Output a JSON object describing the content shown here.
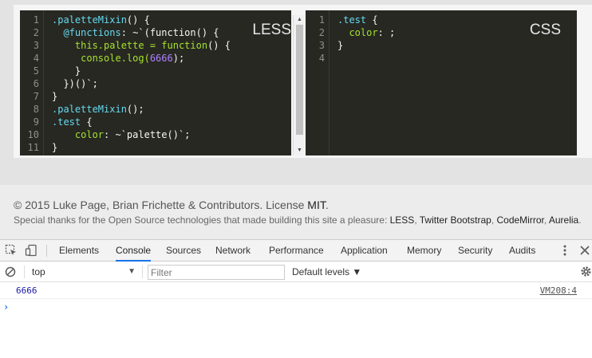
{
  "editor": {
    "less": {
      "label": "LESS",
      "line_numbers": [
        "1",
        "2",
        "3",
        "4",
        "5",
        "6",
        "7",
        "8",
        "9",
        "10",
        "11"
      ],
      "lines": [
        [
          {
            "t": ".paletteMixin",
            "c": "var"
          },
          {
            "t": "() {",
            "c": "plain"
          }
        ],
        [
          {
            "t": "  ",
            "c": "plain"
          },
          {
            "t": "@functions",
            "c": "var"
          },
          {
            "t": ": ~`(function() {",
            "c": "plain"
          }
        ],
        [
          {
            "t": "    this.palette = ",
            "c": "prop"
          },
          {
            "t": "function",
            "c": "prop"
          },
          {
            "t": "() {",
            "c": "plain"
          }
        ],
        [
          {
            "t": "     console.log(",
            "c": "prop"
          },
          {
            "t": "6666",
            "c": "num"
          },
          {
            "t": ");",
            "c": "plain"
          }
        ],
        [
          {
            "t": "    }",
            "c": "plain"
          }
        ],
        [
          {
            "t": "  })()`;",
            "c": "plain"
          }
        ],
        [
          {
            "t": "}",
            "c": "plain"
          }
        ],
        [
          {
            "t": ".paletteMixin",
            "c": "var"
          },
          {
            "t": "();",
            "c": "plain"
          }
        ],
        [
          {
            "t": ".test",
            "c": "var"
          },
          {
            "t": " {",
            "c": "plain"
          }
        ],
        [
          {
            "t": "    color",
            "c": "prop"
          },
          {
            "t": ": ~`palette()`;",
            "c": "plain"
          }
        ],
        [
          {
            "t": "}",
            "c": "plain"
          }
        ]
      ]
    },
    "css": {
      "label": "CSS",
      "line_numbers": [
        "1",
        "2",
        "3",
        "4"
      ],
      "lines": [
        [
          {
            "t": ".test",
            "c": "var"
          },
          {
            "t": " {",
            "c": "plain"
          }
        ],
        [
          {
            "t": "  color",
            "c": "prop"
          },
          {
            "t": ": ;",
            "c": "plain"
          }
        ],
        [
          {
            "t": "}",
            "c": "plain"
          }
        ],
        [
          {
            "t": "",
            "c": "plain"
          }
        ]
      ]
    }
  },
  "footer": {
    "copyright": "© 2015 Luke Page, Brian Frichette & Contributors. License ",
    "license_link": "MIT",
    "period": ".",
    "thanks": "Special thanks for the Open Source technologies that made building this site a pleasure: ",
    "tech_links": [
      "LESS",
      "Twitter Bootstrap",
      "CodeMirror",
      "Aurelia"
    ],
    "sep": ", ",
    "end": "."
  },
  "devtools": {
    "tabs": {
      "elements": "Elements",
      "console": "Console",
      "sources": "Sources",
      "network": "Network",
      "performance": "Performance",
      "application": "Application",
      "memory": "Memory",
      "security": "Security",
      "audits": "Audits"
    },
    "active_tab": "Console",
    "toolbar": {
      "context": "top",
      "filter_placeholder": "Filter",
      "levels": "Default levels ▼"
    },
    "console": {
      "log_value": "6666",
      "log_source": "VM208:4",
      "prompt": "›"
    }
  },
  "colors": {
    "editor_bg": "#272822",
    "accent": "#1a73e8",
    "log_number": "#1a1aa6"
  }
}
